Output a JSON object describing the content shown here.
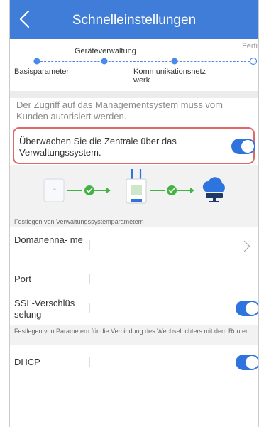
{
  "header": {
    "title": "Schnelleinstellungen"
  },
  "steps": {
    "items": [
      {
        "label": "Basisparameter",
        "state": "done"
      },
      {
        "label": "Geräteverwaltung",
        "state": "active"
      },
      {
        "label": "Kommunikationsnetz werk",
        "state": "upcoming"
      },
      {
        "label": "Ferti",
        "state": "pending"
      }
    ]
  },
  "notice": "Der Zugriff auf das Managementsystem muss vom Kunden autorisiert werden.",
  "monitor": {
    "label": "Überwachen Sie die Zentrale über das Verwaltungssystem.",
    "enabled": true
  },
  "management": {
    "section_title": "Festlegen von Verwaltungssystemparametern",
    "domain_label": "Domänenna- me",
    "domain_value": "",
    "port_label": "Port",
    "port_value": "",
    "ssl_label": "SSL-Verschlüs selung",
    "ssl_enabled": true
  },
  "router": {
    "section_title": "Festlegen von Parametern für die Verbindung des Wechselrichters mit dem Router",
    "dhcp_label": "DHCP",
    "dhcp_enabled": true
  },
  "colors": {
    "header": "#3f7dd8",
    "toggle_on": "#2f74de",
    "connector_green": "#43b343",
    "highlight_border": "#e0666a"
  },
  "icons": {
    "back": "chevron-left-icon",
    "device": "inverter-icon",
    "dongle": "smart-dongle-icon",
    "cloud": "cloud-server-icon",
    "check": "check-circle-icon",
    "arrow": "chevron-right-icon"
  }
}
